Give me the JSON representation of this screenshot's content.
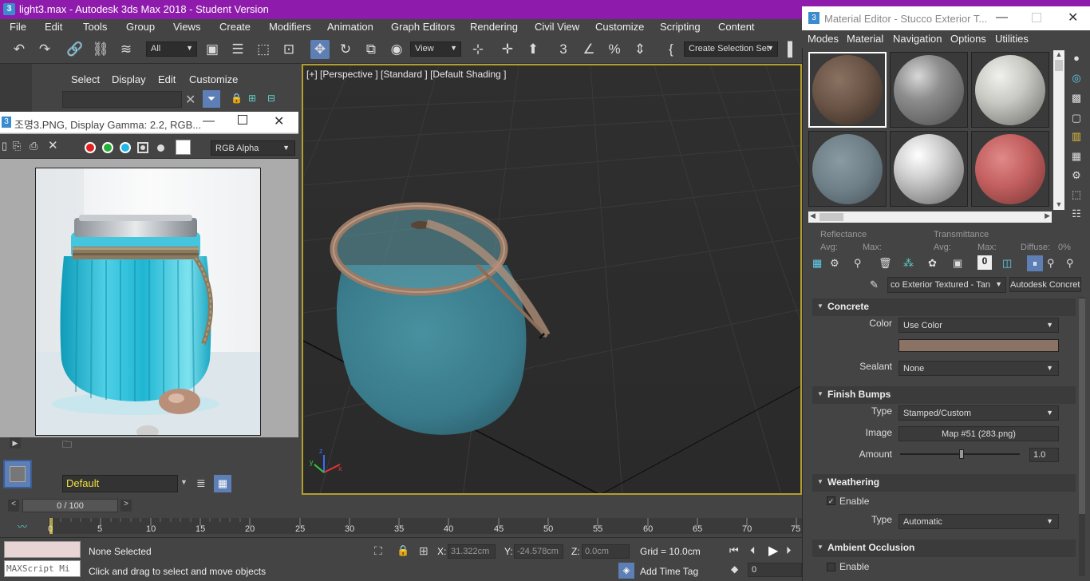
{
  "app": {
    "title": "light3.max - Autodesk 3ds Max 2018 - Student Version",
    "icon": "3"
  },
  "menubar": [
    "File",
    "Edit",
    "Tools",
    "Group",
    "Views",
    "Create",
    "Modifiers",
    "Animation",
    "Graph Editors",
    "Rendering",
    "Civil View",
    "Customize",
    "Scripting",
    "Content"
  ],
  "toolbar": {
    "filter": "All",
    "ref_coord": "View",
    "selection_set": "Create Selection Set"
  },
  "command_panel": {
    "tabs": [
      "Select",
      "Display",
      "Edit",
      "Customize"
    ],
    "layer": "Default"
  },
  "frame_buffer": {
    "title": "조명3.PNG, Display Gamma: 2.2, RGB...",
    "channel": "RGB Alpha",
    "colors": {
      "red": "#e0201e",
      "green": "#26b03a",
      "blue": "#21b7e6"
    }
  },
  "viewport": {
    "label": "[+] [Perspective ] [Standard ] [Default Shading ]"
  },
  "timeline": {
    "frame": "0 / 100",
    "ticks": [
      "0",
      "5",
      "10",
      "15",
      "20",
      "25",
      "30",
      "35",
      "40",
      "45",
      "50",
      "55",
      "60",
      "65",
      "70",
      "75"
    ]
  },
  "status": {
    "selection": "None Selected",
    "prompt": "Click and drag to select and move objects",
    "maxscript": "MAXScript Mi",
    "x_label": "X:",
    "x": "31.322cm",
    "y_label": "Y:",
    "y": "-24.578cm",
    "z_label": "Z:",
    "z": "0.0cm",
    "grid": "Grid = 10.0cm",
    "add_time_tag": "Add Time Tag",
    "frame_field": "0"
  },
  "material_editor": {
    "title": "Material Editor - Stucco Exterior T...",
    "menu": [
      "Modes",
      "Material",
      "Navigation",
      "Options",
      "Utilities"
    ],
    "reflectance": {
      "label": "Reflectance",
      "avg": "Avg:",
      "max": "Max:"
    },
    "transmittance": {
      "label": "Transmittance",
      "avg": "Avg:",
      "max": "Max:",
      "diffuse": "Diffuse:",
      "diffuse_val": "0%"
    },
    "material_name": "co Exterior Textured - Tan",
    "material_type": "Autodesk Concrete",
    "sections": {
      "concrete": {
        "title": "Concrete",
        "color_label": "Color",
        "color_value": "Use Color",
        "swatch": "#8a7264",
        "sealant_label": "Sealant",
        "sealant_value": "None"
      },
      "finish_bumps": {
        "title": "Finish Bumps",
        "type_label": "Type",
        "type_value": "Stamped/Custom",
        "image_label": "Image",
        "image_value": "Map #51 (283.png)",
        "amount_label": "Amount",
        "amount_value": "1.0"
      },
      "weathering": {
        "title": "Weathering",
        "enable": "Enable",
        "type_label": "Type",
        "type_value": "Automatic"
      },
      "ambient_occlusion": {
        "title": "Ambient Occlusion",
        "enable": "Enable"
      }
    }
  }
}
